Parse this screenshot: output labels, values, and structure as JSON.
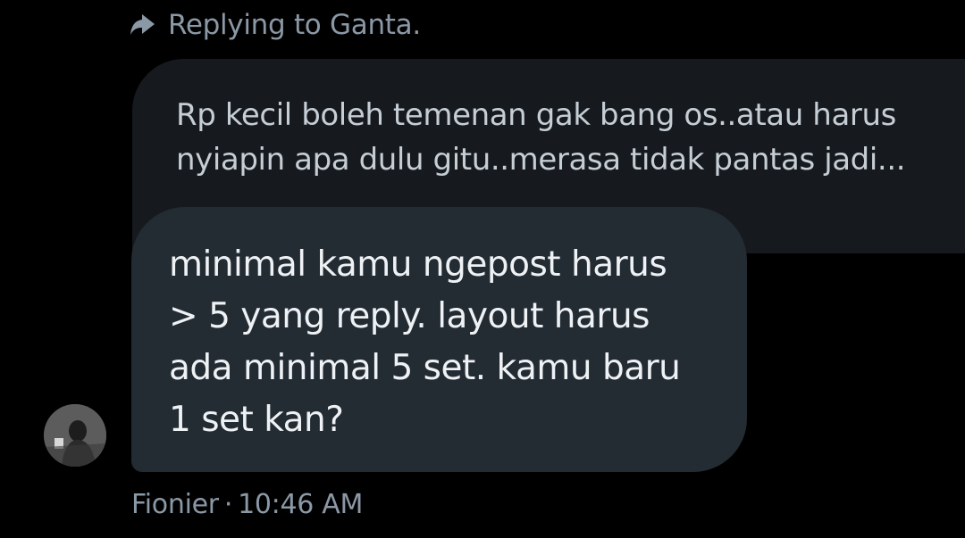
{
  "reply": {
    "label": "Replying to Ganta.",
    "icon": "reply-arrow-icon"
  },
  "quoted_message": {
    "text": "Rp kecil boleh temenan gak bang os..atau harus\nnyiapin apa dulu gitu..merasa tidak pantas jadi..."
  },
  "message": {
    "text": "minimal kamu ngepost harus\n> 5 yang reply. layout harus\nada minimal 5 set. kamu baru\n1 set kan?",
    "sender": "Fionier",
    "separator": "·",
    "time": "10:46 AM"
  },
  "colors": {
    "background": "#000000",
    "quoted_bubble": "#16191d",
    "message_bubble": "#232b33",
    "muted_text": "#8b98a5",
    "message_text": "#eef2f5"
  }
}
